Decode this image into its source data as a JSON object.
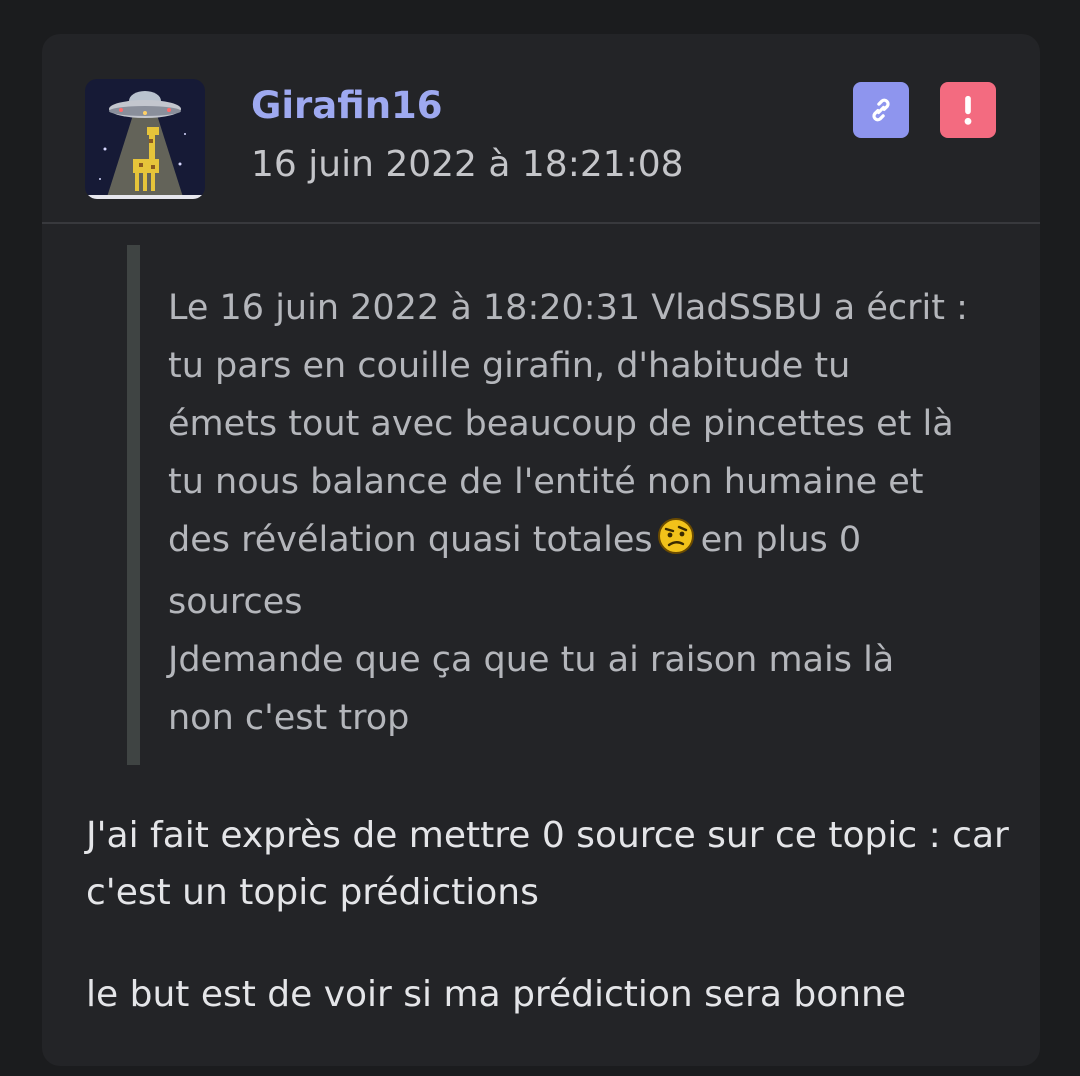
{
  "colors": {
    "page_bg": "#1b1c1e",
    "card_bg": "#232427",
    "username": "#9ea9f0",
    "link_button": "#8e95ee",
    "report_button": "#f36b80"
  },
  "post": {
    "author": {
      "username": "Girafin16",
      "avatar_icon": "ufo-giraffe-avatar"
    },
    "timestamp": "16 juin 2022 à 18:21:08",
    "actions": {
      "link_icon": "link-icon",
      "report_icon": "exclamation-icon"
    },
    "quote": {
      "header": "Le 16 juin 2022 à 18:20:31 VladSSBU a écrit :",
      "line1": "tu pars en couille girafin, d'habitude tu",
      "line2": "émets tout avec beaucoup de pincettes et là",
      "line3": "tu nous balance de l'entité non humaine et",
      "line4_before": "des révélation quasi totales",
      "line4_icon": "skeptical-smiley-icon",
      "line4_after": "en plus 0",
      "line5": "sources",
      "line6": "Jdemande que ça que tu ai raison mais là",
      "line7": "non c'est trop"
    },
    "body": {
      "p1_line1": "J'ai fait exprès de mettre 0 source sur ce topic : car",
      "p1_line2": "c'est un topic prédictions",
      "p2": "le but est de voir si ma prédiction sera bonne"
    }
  }
}
